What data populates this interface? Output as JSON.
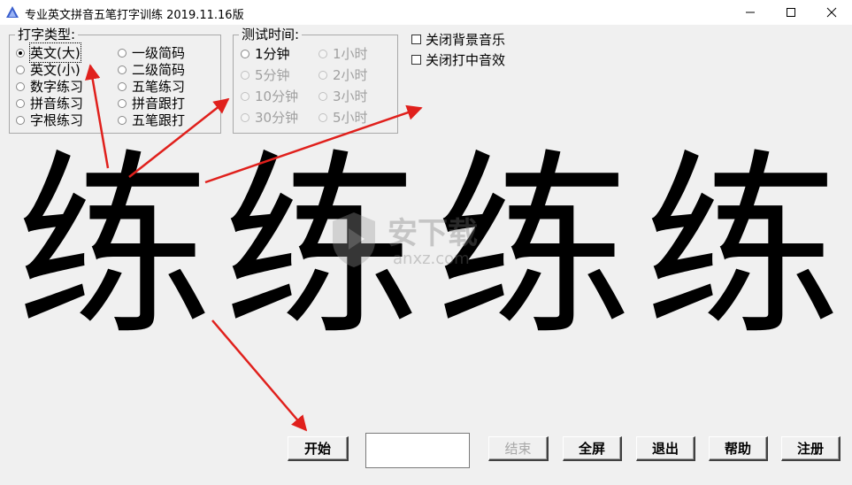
{
  "window": {
    "title": "专业英文拼音五笔打字训练  2019.11.16版",
    "controls": [
      "minimize-icon",
      "maximize-icon",
      "close-icon"
    ]
  },
  "type_group": {
    "legend": "打字类型:",
    "options_left": [
      "英文(大)",
      "英文(小)",
      "数字练习",
      "拼音练习",
      "字根练习"
    ],
    "options_right": [
      "一级简码",
      "二级简码",
      "五笔练习",
      "拼音跟打",
      "五笔跟打"
    ],
    "selected": "英文(大)"
  },
  "time_group": {
    "legend": "测试时间:",
    "options_left": [
      "1分钟",
      "5分钟",
      "10分钟",
      "30分钟"
    ],
    "options_right": [
      "1小时",
      "2小时",
      "3小时",
      "5小时"
    ]
  },
  "checkboxes": {
    "bg_music": "关闭背景音乐",
    "hit_sound": "关闭打中音效"
  },
  "practice_chars": [
    "练",
    "练",
    "练",
    "练"
  ],
  "watermark": {
    "text": "安下载",
    "url": "anxz.com"
  },
  "buttons": {
    "start": "开始",
    "end": "结束",
    "fullscreen": "全屏",
    "exit": "退出",
    "help": "帮助",
    "register": "注册"
  },
  "colors": {
    "annotation_arrow": "#e0201c",
    "window_bg": "#f0f0f0"
  }
}
